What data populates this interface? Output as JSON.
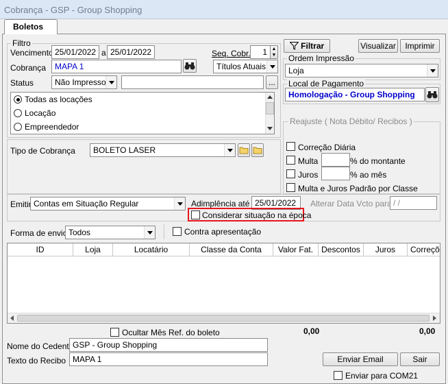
{
  "window": {
    "title": "Cobrança - GSP - Group Shopping"
  },
  "tabs": [
    {
      "label": "Boletos"
    }
  ],
  "filtro": {
    "legend": "Filtro",
    "vencimento_label": "Vencimento",
    "date_from": "25/01/2022",
    "date_sep": "a",
    "date_to": "25/01/2022",
    "seq_label": "Seq. Cobr.:",
    "seq_value": "1",
    "cobranca_label": "Cobrança",
    "cobranca_value": "MAPA 1",
    "titulos_value": "Títulos Atuais",
    "status_label": "Status",
    "status_value": "Não Impresso",
    "status_extra": "",
    "ellipsis": "...",
    "radios": [
      {
        "label": "Todas as locações",
        "selected": true
      },
      {
        "label": "Locação",
        "selected": false
      },
      {
        "label": "Empreendedor",
        "selected": false
      }
    ]
  },
  "toolbar": {
    "filtrar": "Filtrar",
    "visualizar": "Visualizar",
    "imprimir": "Imprimir"
  },
  "ordem": {
    "legend": "Ordem Impressão",
    "value": "Loja"
  },
  "local": {
    "legend": "Local de Pagamento",
    "value": "Homologação - Group Shopping"
  },
  "reajuste": {
    "legend": "Reajuste ( Nota Débito/ Recibos )",
    "correcao": "Correção Diária",
    "multa": "Multa",
    "multa_suffix": "% do montante",
    "juros": "Juros",
    "juros_suffix": "% ao mês",
    "padrao": "Multa e Juros Padrão por Classe"
  },
  "tipo": {
    "label": "Tipo de Cobrança",
    "value": "BOLETO LASER"
  },
  "emitir": {
    "label": "Emitir",
    "value": "Contas em Situação Regular",
    "adimplencia_label": "Adimplência até",
    "adimplencia_value": "25/01/2022",
    "considerar": "Considerar situação na época",
    "alterar_label": "Alterar Data Vcto para",
    "alterar_value": "/ /"
  },
  "envio": {
    "label": "Forma de envio",
    "value": "Todos",
    "contra": "Contra apresentação"
  },
  "table": {
    "columns": [
      "ID",
      "Loja",
      "Locatário",
      "Classe da Conta",
      "Valor Fat.",
      "Descontos",
      "Juros",
      "Correções"
    ]
  },
  "footer": {
    "ocultar": "Ocultar Mês Ref. do boleto",
    "total1": "0,00",
    "total2": "0,00",
    "cedente_label": "Nome do Cedente",
    "cedente_value": "GSP - Group Shopping",
    "recibo_label": "Texto do Recibo",
    "recibo_value": "MAPA 1",
    "enviar_email": "Enviar Email",
    "sair": "Sair",
    "enviar_com21": "Enviar para COM21"
  },
  "colors": {
    "highlight": "#e8141b",
    "link_blue": "#0000cc",
    "title_text": "#6f7e90"
  }
}
